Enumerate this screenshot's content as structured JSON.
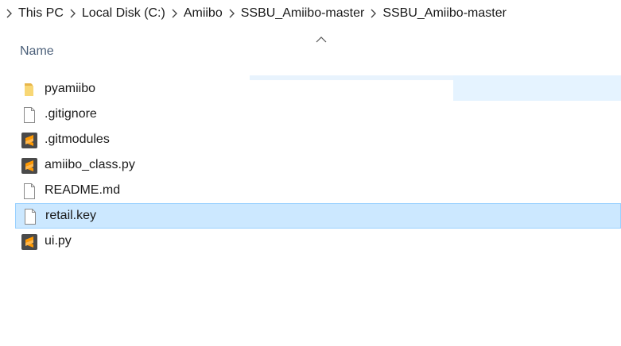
{
  "breadcrumb": {
    "items": [
      {
        "label": "This PC"
      },
      {
        "label": "Local Disk (C:)"
      },
      {
        "label": "Amiibo"
      },
      {
        "label": "SSBU_Amiibo-master"
      },
      {
        "label": "SSBU_Amiibo-master"
      }
    ]
  },
  "list": {
    "column_header": "Name",
    "sort_direction": "ascending",
    "files": [
      {
        "name": "pyamiibo",
        "icon": "folder-icon",
        "selected": false
      },
      {
        "name": ".gitignore",
        "icon": "document-icon",
        "selected": false
      },
      {
        "name": ".gitmodules",
        "icon": "sublime-text-icon",
        "selected": false
      },
      {
        "name": "amiibo_class.py",
        "icon": "sublime-text-icon",
        "selected": false
      },
      {
        "name": "README.md",
        "icon": "document-icon",
        "selected": false
      },
      {
        "name": "retail.key",
        "icon": "document-icon",
        "selected": true
      },
      {
        "name": "ui.py",
        "icon": "sublime-text-icon",
        "selected": false
      }
    ]
  },
  "colors": {
    "selection_bg": "#cce8ff",
    "selection_border": "#99d1ff",
    "header_text": "#4c607a",
    "folder": "#f8d775",
    "sublime_bg": "#4a4a4a",
    "sublime_accent": "#ff9800"
  }
}
